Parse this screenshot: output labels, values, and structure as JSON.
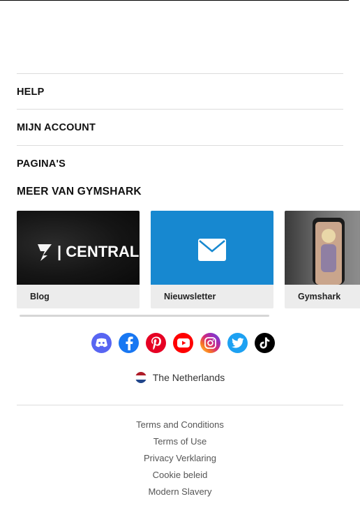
{
  "accordion": [
    {
      "label": "HELP"
    },
    {
      "label": "MIJN ACCOUNT"
    },
    {
      "label": "PAGINA'S"
    }
  ],
  "more": {
    "title": "MEER VAN GYMSHARK",
    "cards": [
      {
        "label": "Blog",
        "image_text": "| CENTRAL"
      },
      {
        "label": "Nieuwsletter"
      },
      {
        "label": "Gymshark"
      }
    ]
  },
  "social": [
    {
      "name": "discord-icon",
      "color": "#5865f2"
    },
    {
      "name": "facebook-icon",
      "color": "#1877f2"
    },
    {
      "name": "pinterest-icon",
      "color": "#e60023"
    },
    {
      "name": "youtube-icon",
      "color": "#ff0000"
    },
    {
      "name": "instagram-icon",
      "color": "#d62976"
    },
    {
      "name": "twitter-icon",
      "color": "#1da1f2"
    },
    {
      "name": "tiktok-icon",
      "color": "#000000"
    }
  ],
  "country": {
    "name": "The Netherlands",
    "flag_colors": [
      "#ae1c28",
      "#ffffff",
      "#21468b"
    ]
  },
  "footer_links": [
    "Terms and Conditions",
    "Terms of Use",
    "Privacy Verklaring",
    "Cookie beleid",
    "Modern Slavery"
  ]
}
